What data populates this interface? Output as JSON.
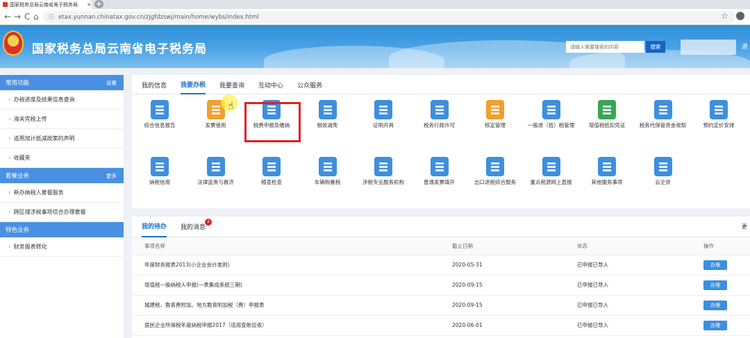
{
  "browser": {
    "tab_title": "国家税务总局云南省电子税务局",
    "tab_close": "×",
    "new_tab": "+",
    "back": "←",
    "forward": "→",
    "reload": "C",
    "home": "⌂",
    "lock": "ⓘ",
    "url": "etax.yunnan.chinatax.gov.cn/zjgfdzswj/main/home/wybs/index.html",
    "star": "☆"
  },
  "header": {
    "title": "国家税务总局云南省电子税务局",
    "search_placeholder": "请输入需要搜索的内容",
    "search_button": "搜索",
    "logout": "退"
  },
  "sidebar": {
    "sections": [
      {
        "title": "常用功能",
        "more": "设置",
        "items": [
          "办税进度及结果信息查询",
          "海关完税上传",
          "适用加计抵减政策的声明",
          "收藏夹"
        ]
      },
      {
        "title": "套餐业务",
        "more": "更多",
        "items": [
          "新办纳税人套餐服务",
          "跨区域涉税事项综合办理套餐"
        ]
      },
      {
        "title": "特色业务",
        "more": "",
        "items": [
          "财务报表转化"
        ]
      }
    ]
  },
  "main": {
    "tabs": [
      {
        "label": "我的信息",
        "active": false
      },
      {
        "label": "我要办税",
        "active": true
      },
      {
        "label": "我要查询",
        "active": false
      },
      {
        "label": "互动中心",
        "active": false
      },
      {
        "label": "公众服务",
        "active": false
      }
    ],
    "services_row1": [
      {
        "label": "综合信息报告",
        "color": "#3f8fdc",
        "icon": "report-icon"
      },
      {
        "label": "发票使用",
        "color": "#f0a030",
        "icon": "invoice-printer-icon"
      },
      {
        "label": "税费申报及缴纳",
        "color": "#3f8fdc",
        "icon": "tax-declare-icon"
      },
      {
        "label": "税收减免",
        "color": "#3f8fdc",
        "icon": "tax-relief-icon"
      },
      {
        "label": "证明开具",
        "color": "#3f8fdc",
        "icon": "certificate-icon"
      },
      {
        "label": "税务行政许可",
        "color": "#3f8fdc",
        "icon": "binders-icon"
      },
      {
        "label": "核定管理",
        "color": "#f0a030",
        "icon": "verify-icon"
      },
      {
        "label": "一般退（抵）税管理",
        "color": "#3f8fdc",
        "icon": "refund-icon"
      },
      {
        "label": "增值税抵扣凭证",
        "color": "#3aa655",
        "icon": "vat-deduct-icon"
      },
      {
        "label": "税务代保管资金收取",
        "color": "#3f8fdc",
        "icon": "custody-icon"
      },
      {
        "label": "预约定价安排",
        "color": "#3f8fdc",
        "icon": "calendar-icon"
      }
    ],
    "services_row2": [
      {
        "label": "纳税信用",
        "color": "#3f8fdc",
        "icon": "credit-icon"
      },
      {
        "label": "法律追责与救济",
        "color": "#3f8fdc",
        "icon": "legal-icon"
      },
      {
        "label": "稽查检查",
        "color": "#3f8fdc",
        "icon": "inspection-icon"
      },
      {
        "label": "车辆购置税",
        "color": "#3f8fdc",
        "icon": "vehicle-icon"
      },
      {
        "label": "涉税专业服务机构",
        "color": "#3f8fdc",
        "icon": "agency-icon"
      },
      {
        "label": "普通发票填开",
        "color": "#3f8fdc",
        "icon": "invoice-issue-icon"
      },
      {
        "label": "出口退税综合服务",
        "color": "#3f8fdc",
        "icon": "ship-icon"
      },
      {
        "label": "重点税源网上直报",
        "color": "#3f8fdc",
        "icon": "key-source-icon"
      },
      {
        "label": "其他服务事项",
        "color": "#3f8fdc",
        "icon": "other-icon"
      },
      {
        "label": "云企贷",
        "color": "#3f8fdc",
        "icon": "loan-icon"
      }
    ]
  },
  "todo": {
    "tabs": [
      {
        "label": "我的待办",
        "active": true
      },
      {
        "label": "我的消息",
        "active": false
      }
    ],
    "badge": "2",
    "more": "更",
    "columns": [
      "事项名称",
      "截止日期",
      "状态",
      "操作"
    ],
    "rows": [
      {
        "name": "年度财务报表2013(小企业会计准则)",
        "deadline": "2020-05-31",
        "status": "已申报已导入",
        "action": "办理"
      },
      {
        "name": "增值税一般纳税人申报(一表集成系统三期)",
        "deadline": "2020-09-15",
        "status": "已申报已导入",
        "action": "办理"
      },
      {
        "name": "城建税、教育费附加、地方教育附加税（费）申报表",
        "deadline": "2020-09-15",
        "status": "已申报已导入",
        "action": "办理"
      },
      {
        "name": "居民企业所得税年度纳税申报2017（适用查账征收）",
        "deadline": "2020-06-01",
        "status": "已申报已导入",
        "action": "办理"
      }
    ]
  }
}
